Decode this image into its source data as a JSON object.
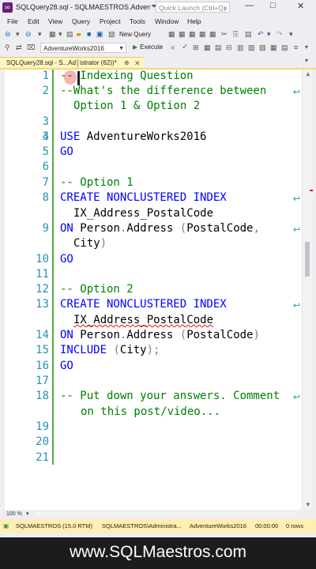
{
  "window": {
    "title": "SQLQuery28.sql - SQLMAESTROS.Adventure...",
    "quick_launch_placeholder": "Quick Launch (Ctrl+Q)",
    "minimize": "—",
    "maximize": "□",
    "close": "✕"
  },
  "menu": [
    "File",
    "Edit",
    "View",
    "Query",
    "Project",
    "Tools",
    "Window",
    "Help"
  ],
  "toolbar": {
    "new_query": "New Query"
  },
  "toolbar2": {
    "database": "AdventureWorks2016",
    "execute": "Execute"
  },
  "tab": {
    "label": "SQLQuery28.sql - S...Ad│istrator (62))*",
    "pin": "⊕",
    "close": "✕"
  },
  "editor": {
    "line_numbers": [
      "1",
      "2",
      "",
      "3",
      "4",
      "5",
      "6",
      "7",
      "8",
      "",
      "9",
      "",
      "10",
      "11",
      "12",
      "13",
      "",
      "14",
      "15",
      "16",
      "17",
      "18",
      "",
      "19",
      "20",
      "21"
    ],
    "lines": [
      {
        "num": "1",
        "text": "-- Indexing Question"
      },
      {
        "num": "2",
        "text": "--What's the difference between"
      },
      {
        "num": "",
        "text": "Option 1 & Option 2"
      },
      {
        "num": "3",
        "text": ""
      },
      {
        "num": "4",
        "text": "USE AdventureWorks2016"
      },
      {
        "num": "5",
        "text": "GO"
      },
      {
        "num": "6",
        "text": ""
      },
      {
        "num": "7",
        "text": "-- Option 1"
      },
      {
        "num": "8",
        "text": "CREATE NONCLUSTERED INDEX"
      },
      {
        "num": "",
        "text": "IX_Address_PostalCode"
      },
      {
        "num": "9",
        "text": "ON Person.Address (PostalCode,"
      },
      {
        "num": "",
        "text": "City)"
      },
      {
        "num": "10",
        "text": "GO"
      },
      {
        "num": "11",
        "text": ""
      },
      {
        "num": "12",
        "text": "-- Option 2"
      },
      {
        "num": "13",
        "text": "CREATE NONCLUSTERED INDEX"
      },
      {
        "num": "",
        "text": "IX_Address_PostalCode"
      },
      {
        "num": "14",
        "text": "ON Person.Address (PostalCode)"
      },
      {
        "num": "15",
        "text": "INCLUDE (City);"
      },
      {
        "num": "16",
        "text": "GO"
      },
      {
        "num": "17",
        "text": ""
      },
      {
        "num": "18",
        "text": "-- Put down your answers. Comment"
      },
      {
        "num": "",
        "text": "on this post/video..."
      },
      {
        "num": "19",
        "text": ""
      },
      {
        "num": "20",
        "text": ""
      },
      {
        "num": "21",
        "text": ""
      }
    ],
    "tokens": {
      "l1": "-- Indexing Question",
      "l2": "--What's the difference between",
      "l2b": "Option 1 & Option 2",
      "use": "USE",
      "db": "AdventureWorks2016",
      "go": "GO",
      "opt1": "-- Option 1",
      "create": "CREATE NONCLUSTERED INDEX",
      "ixname": "IX_Address_PostalCode",
      "on": "ON",
      "person": "Person",
      "dot": ".",
      "address": "Address",
      "paren_open": "(",
      "postal": "PostalCode",
      "comma": ",",
      "city": "City",
      "paren_close": ")",
      "opt2": "-- Option 2",
      "include": "INCLUDE",
      "semi": ";",
      "l18": "-- Put down your answers. Comment",
      "l18b": "on this post/video..."
    }
  },
  "zoom": "100 %",
  "status": {
    "server": "SQLMAESTROS (15.0 RTM)",
    "user": "SQLMAESTROS\\Administra...",
    "database": "AdventureWorks2016",
    "time": "00:00:00",
    "rows": "0 rows"
  },
  "footer": {
    "url": "www.SQLMaestros.com"
  },
  "colors": {
    "comment": "#008000",
    "keyword": "#0000ff",
    "line_number": "#2b91af",
    "status_bar": "#ffefb0",
    "tab_active": "#fff6bf"
  }
}
